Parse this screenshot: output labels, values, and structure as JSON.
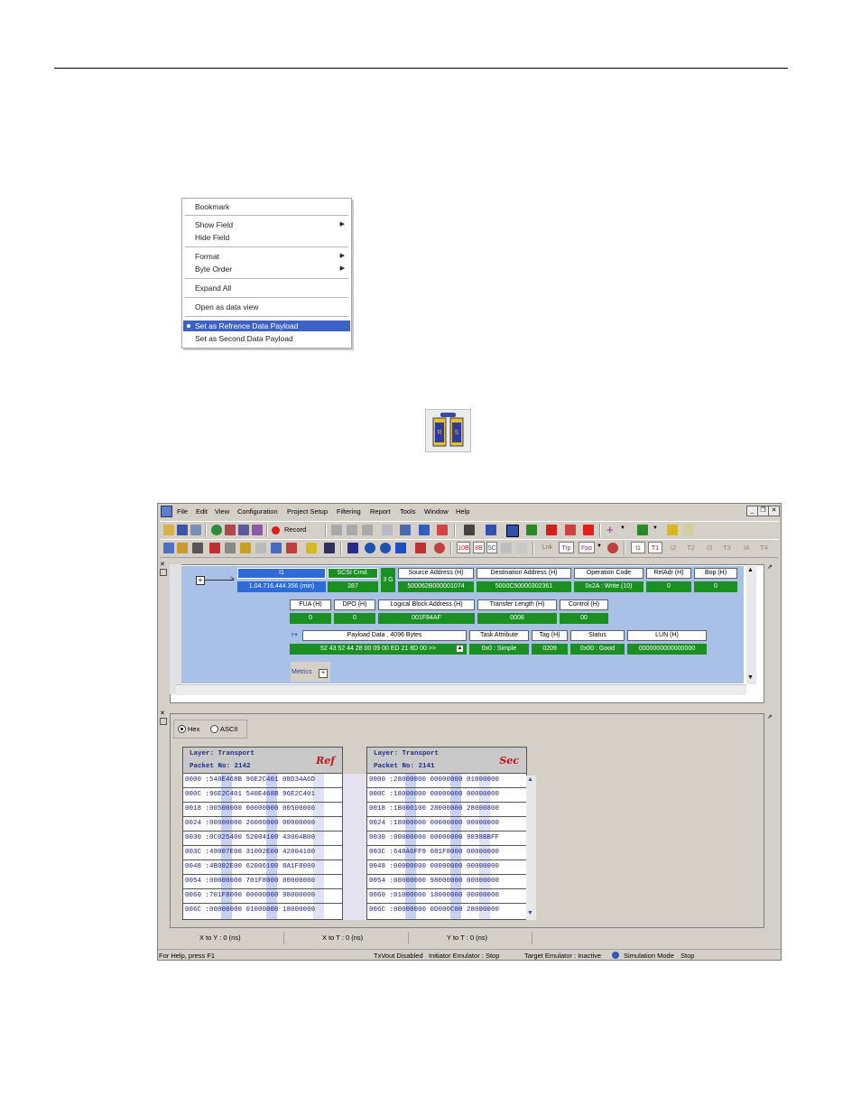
{
  "context_menu": {
    "items": [
      "Bookmark",
      "Show Field",
      "Hide Field",
      "Format",
      "Byte Order",
      "Expand All",
      "Open as data view",
      "Set as Refrence Data Payload",
      "Set as Second Data Payload"
    ]
  },
  "app": {
    "menu": [
      "File",
      "Edit",
      "View",
      "Configuration",
      "Project Setup",
      "Filtering",
      "Report",
      "Tools",
      "Window",
      "Help"
    ],
    "toolbar": {
      "record_label": "Record",
      "speed_18": "10B",
      "speed_8": "8B",
      "speed_sc": "SC",
      "lnk": "Lnk",
      "trp": "Trp",
      "fpp": "Fpp",
      "t_tabs": [
        "I1",
        "T1",
        "I2",
        "T2",
        "I3",
        "T3",
        "I4",
        "T4"
      ]
    },
    "packet": {
      "col1_head": "I1",
      "col1_val": "1.04.716.444.356 (min)",
      "col2_head": "SCSI Cmd.",
      "col2_val": "287",
      "rate": "3 G",
      "row1": [
        {
          "h": "Source Address (H)",
          "v": "500062B000001074"
        },
        {
          "h": "Destination Address (H)",
          "v": "5000C50000302361"
        },
        {
          "h": "Operation Code",
          "v": "0x2A : Write (10)"
        },
        {
          "h": "RelAdr (H)",
          "v": "0"
        },
        {
          "h": "Bop (H)",
          "v": "0"
        }
      ],
      "row2": [
        {
          "h": "FUA (H)",
          "v": "0"
        },
        {
          "h": "DPO (H)",
          "v": "0"
        },
        {
          "h": "Logical Block Address (H)",
          "v": "001F84AF"
        },
        {
          "h": "Transfer Length (H)",
          "v": "0008"
        },
        {
          "h": "Control (H)",
          "v": "00"
        }
      ],
      "row3": [
        {
          "h": "Payload Data , 4096 Bytes",
          "v": "52 43 52 44 28 00 09 00 ED 21 8D 00  >>"
        },
        {
          "h": "Task Attribute",
          "v": "0x0 : Simple"
        },
        {
          "h": "Tag (H)",
          "v": "0209"
        },
        {
          "h": "Status",
          "v": "0x00 : Good"
        },
        {
          "h": "LUN (H)",
          "v": "0000000000000000"
        }
      ],
      "metrics": "Metrics"
    },
    "data_view": {
      "radio_hex": "Hex",
      "radio_ascii": "ASCII",
      "ref": {
        "layer": "Layer: Transport",
        "packet": "Packet No: 2142",
        "tag": "Ref",
        "rows": [
          "0000 :540E468B 96E2C401 08D34A6D",
          "000C :96E2C401 540E468B 96E2C401",
          "0018 :00500000 00000000 00500000",
          "0024 :00000000 26000000 00000000",
          "0030 :0C025400 52004100 43004B00",
          "003C :49007E00 31002E00 42004100",
          "0048 :4B002E00 62006100 8A1F8000",
          "0054 :00000000 701F8000 00000000",
          "0060 :701F8000 00000000 98000000",
          "006C :00000000 01000000 18000000"
        ]
      },
      "sec": {
        "layer": "Layer: Transport",
        "packet": "Packet No: 2141",
        "tag": "Sec",
        "rows": [
          "0000 :28000000 00000000 01000000",
          "000C :18000000 00000000 00000000",
          "0018 :1B000100 28000000 28000800",
          "0024 :18000000 00000000 00000000",
          "0030 :00000000 00000000 9898BBFF",
          "003C :648A6FF9 081F8000 00000000",
          "0048 :00000000 00000000 00000000",
          "0054 :00000000 98000000 00000000",
          "0060 :01000000 18000000 00000000",
          "006C :00000000 0D000C00 28000000"
        ]
      }
    },
    "measure": {
      "xy": "X to Y : 0 (ns)",
      "xt": "X to T : 0 (ns)",
      "yt": "Y to T : 0 (ns)"
    },
    "status": {
      "help": "For Help, press F1",
      "txvout": "TxVout Disabled",
      "initiator": "Initiator Emulator : Stop",
      "target": "Target Emulator : Inactive",
      "sim": "Simulation Mode",
      "stop": "Stop"
    }
  }
}
